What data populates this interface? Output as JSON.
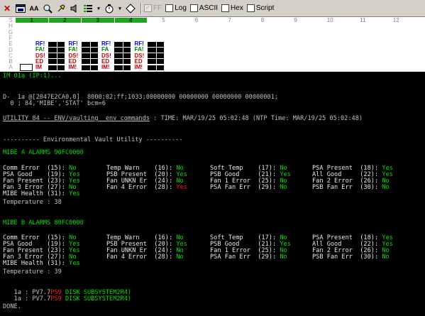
{
  "toolbar": {
    "buttons": [
      "close-icon",
      "window-icon",
      "aa-icon",
      "search-icon",
      "pin-icon",
      "speaker-icon",
      "list-icon",
      "timer-icon",
      "diamond-icon"
    ],
    "aa_label": "AA",
    "checks": [
      {
        "label": "FF",
        "checked": true,
        "disabled": true
      },
      {
        "label": "Log",
        "checked": false,
        "disabled": false
      },
      {
        "label": "ASCII",
        "checked": false,
        "disabled": false
      },
      {
        "label": "Hex",
        "checked": false,
        "disabled": false
      },
      {
        "label": "Script",
        "checked": false,
        "disabled": false
      }
    ]
  },
  "grid": {
    "rows": [
      "S",
      "H",
      "G",
      "F",
      "E",
      "D",
      "C",
      "B",
      "A"
    ],
    "columns": [
      "1",
      "2",
      "3",
      "4",
      "5",
      "6",
      "7",
      "8",
      "9",
      "10",
      "11",
      "12"
    ],
    "active_columns": 4,
    "status_labels": [
      [
        "RF!",
        "FA!",
        "DS!",
        "ED",
        "IM"
      ],
      [
        "RF!",
        "FA!",
        "DS!",
        "ED",
        "IM!"
      ],
      [
        "RF!",
        "FA",
        "DS!",
        "ED",
        "IM!"
      ],
      [
        "RF!",
        "FA!",
        "DS!",
        "ED",
        "IM!"
      ]
    ],
    "label_colors": {
      "RF!": "#0000cc",
      "FA!": "#008000",
      "FA": "#008000",
      "DS!": "#cc0000",
      "ED": "#cc0000",
      "IM": "#cc0000",
      "IM!": "#cc0000"
    }
  },
  "terminal": {
    "prompt": "IM 01a (IP:1)...",
    "cmd_line1": "D-  1a @[2047E2CA0,0]  8000;02;ff;1033;00000000 00000000 00000000 00000001;",
    "cmd_line2": "  0 ; 84,'MIBE','STAT' bcm=6",
    "utility_label": "UTILITY 84 -- ENV/vaulting  env_commands",
    "time_text": " : TIME: MAR/19/25 05:02:48 (NTP Time: MAR/19/25 05:02:48)",
    "section_title": "---------- Environmental Vault Utility ----------",
    "mibe_a": {
      "title": "MIBE A ALARMS 90FC0000",
      "rows": [
        [
          [
            "Comm Error  (15):",
            "No"
          ],
          [
            "Temp Warn    (16):",
            "No"
          ],
          [
            "Soft Temp    (17):",
            "No"
          ],
          [
            "PSA Present  (18):",
            "Yes"
          ]
        ],
        [
          [
            "PSA Good    (19):",
            "Yes"
          ],
          [
            "PSB Present  (20):",
            "Yes"
          ],
          [
            "PSB Good     (21):",
            "Yes"
          ],
          [
            "All Good     (22):",
            "Yes"
          ]
        ],
        [
          [
            "Fan Present (23):",
            "Yes"
          ],
          [
            "Fan UNKN Er  (24):",
            "No"
          ],
          [
            "Fan 1 Error  (25):",
            "No"
          ],
          [
            "Fan 2 Error  (26):",
            "No"
          ]
        ],
        [
          [
            "Fan 3 Error (27):",
            "No"
          ],
          [
            "Fan 4 Error  (28):",
            "Yes"
          ],
          [
            "PSA Fan Err  (29):",
            "No"
          ],
          [
            "PSB Fan Err  (30):",
            "No"
          ]
        ],
        [
          [
            "MIBE Health (31):",
            "Yes"
          ]
        ]
      ],
      "temperature": "Temperature : 38"
    },
    "mibe_b": {
      "title": "MIBE B ALARMS 80FC0000",
      "rows": [
        [
          [
            "Comm Error  (15):",
            "No"
          ],
          [
            "Temp Warn    (16):",
            "No"
          ],
          [
            "Soft Temp    (17):",
            "No"
          ],
          [
            "PSA Present  (18):",
            "Yes"
          ]
        ],
        [
          [
            "PSA Good    (19):",
            "Yes"
          ],
          [
            "PSB Present  (20):",
            "Yes"
          ],
          [
            "PSB Good     (21):",
            "Yes"
          ],
          [
            "All Good     (22):",
            "Yes"
          ]
        ],
        [
          [
            "Fan Present (23):",
            "Yes"
          ],
          [
            "Fan UNKN Er  (24):",
            "No"
          ],
          [
            "Fan 1 Error  (25):",
            "No"
          ],
          [
            "Fan 2 Error  (26):",
            "No"
          ]
        ],
        [
          [
            "Fan 3 Error (27):",
            "No"
          ],
          [
            "Fan 4 Error  (28):",
            "No"
          ],
          [
            "PSA Fan Err  (29):",
            "No"
          ],
          [
            "PSB Fan Err  (30):",
            "No"
          ]
        ],
        [
          [
            "MIBE Health (31):",
            "Yes"
          ]
        ]
      ],
      "temperature": "Temperature : 39"
    },
    "disk_lines": [
      {
        "prefix": "   1a : PV7.7",
        "red": "PS9",
        "suffix": " DISK SUBSYSTEM2R4)"
      },
      {
        "prefix": "   1a : PV7.7",
        "red": "PS9",
        "suffix": " DISK SUBSYSTEM2R4)"
      }
    ],
    "done": "DONE."
  }
}
